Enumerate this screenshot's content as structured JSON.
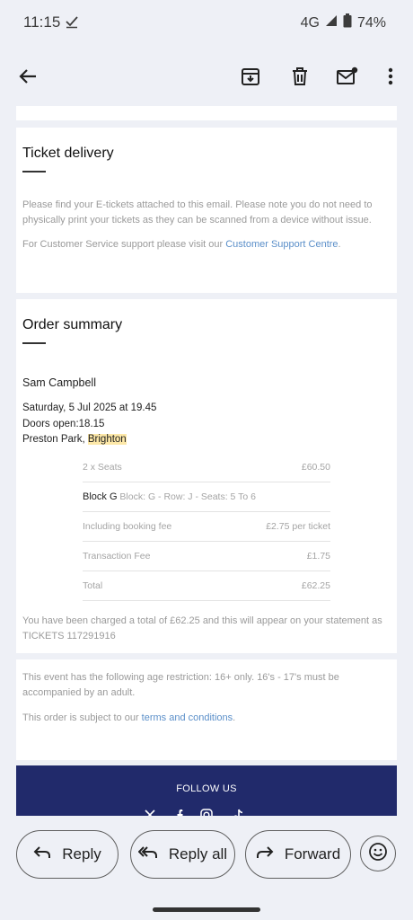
{
  "status": {
    "time": "11:15",
    "network": "4G",
    "battery": "74%"
  },
  "icons": {
    "back": "arrow-back-icon",
    "archive": "archive-icon",
    "delete": "trash-icon",
    "unread": "mark-unread-icon",
    "more": "more-vert-icon"
  },
  "ticket_delivery": {
    "title": "Ticket delivery",
    "para1": "Please find your E-tickets attached to this email. Please note you do not need to physically print your tickets as they can be scanned from a device without issue.",
    "para2_prefix": "For Customer Service support please visit our ",
    "para2_link": "Customer Support Centre",
    "para2_suffix": "."
  },
  "order_summary": {
    "title": "Order summary",
    "customer_name": "Sam Campbell",
    "date_line": "Saturday, 5 Jul 2025 at 19.45",
    "doors_line": "Doors open:18.15",
    "venue_prefix": "Preston Park, ",
    "venue_city": "Brighton",
    "rows": [
      {
        "label": "2 x Seats",
        "value": "£60.50"
      },
      {
        "label_bold": "Block G",
        "label": " Block: G - Row: J - Seats: 5 To 6",
        "value": ""
      },
      {
        "label": "Including booking fee",
        "value": "£2.75 per ticket"
      },
      {
        "label": "Transaction Fee",
        "value": "£1.75"
      },
      {
        "label": "Total",
        "value": "£62.25"
      }
    ],
    "charge_note": "You have been charged a total of £62.25 and this will appear on your statement as TICKETS 117291916"
  },
  "restrictions": {
    "age_note": "This event has the following age restriction: 16+ only. 16's - 17's must be accompanied by an adult.",
    "terms_prefix": "This order is subject to our ",
    "terms_link": "terms and conditions",
    "terms_suffix": "."
  },
  "footer": {
    "follow_label": "FOLLOW US"
  },
  "actions": {
    "reply": "Reply",
    "reply_all": "Reply all",
    "forward": "Forward"
  },
  "colors": {
    "brand_footer": "#212a6b",
    "link": "#5b8fc9",
    "highlight": "#fde8a8"
  }
}
